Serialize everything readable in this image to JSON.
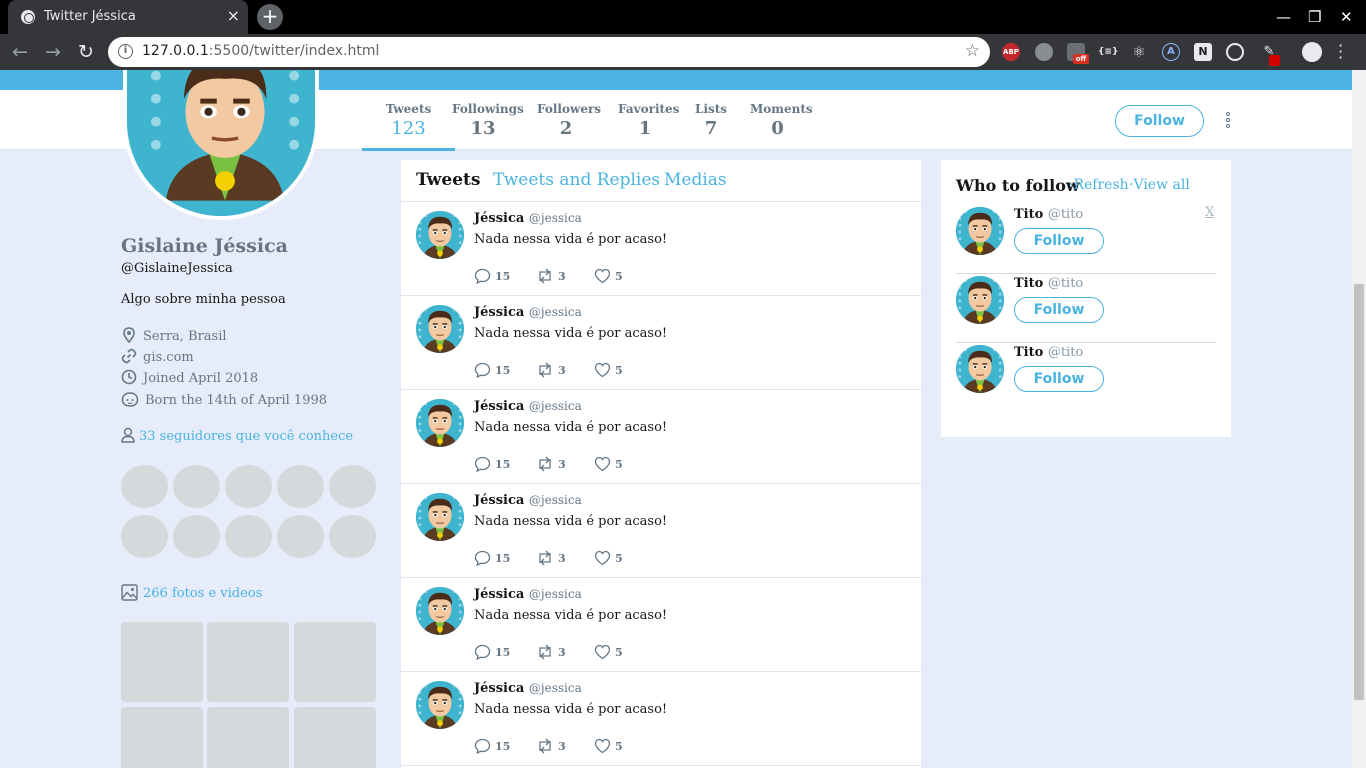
{
  "browser": {
    "tab_title": "Twitter Jéssica",
    "tab_close": "×",
    "new_tab": "+",
    "url_host": "127.0.0.1",
    "url_rest": ":5500/twitter/index.html",
    "window_minimize": "—",
    "window_maximize": "❐",
    "window_close": "✕",
    "ext_abp": "ABP",
    "ext_off": "off",
    "ext_braces": "{≡}",
    "ext_a": "A",
    "ext_n": "N"
  },
  "stats": [
    {
      "label": "Tweets",
      "value": "123",
      "active": true
    },
    {
      "label": "Followings",
      "value": "13"
    },
    {
      "label": "Followers",
      "value": "2"
    },
    {
      "label": "Favorites",
      "value": "1"
    },
    {
      "label": "Lists",
      "value": "7"
    },
    {
      "label": "Moments",
      "value": "0"
    }
  ],
  "header_follow_label": "Follow",
  "profile": {
    "name": "Gislaine Jéssica",
    "handle": "@GislaineJessica",
    "bio": "Algo sobre minha pessoa",
    "location": "Serra, Brasil",
    "website": "gis.com",
    "joined": "Joined April 2018",
    "born": "Born the 14th of April 1998",
    "known_followers": "33 seguidores que você conhece",
    "photos_videos": "266 fotos e videos"
  },
  "timeline": {
    "tabs": [
      "Tweets",
      "Tweets and Replies",
      "Medias"
    ],
    "tweets": [
      {
        "name": "Jéssica",
        "handle": "@jessica",
        "text": "Nada nessa vida é por acaso!",
        "replies": "15",
        "retweets": "3",
        "likes": "5"
      },
      {
        "name": "Jéssica",
        "handle": "@jessica",
        "text": "Nada nessa vida é por acaso!",
        "replies": "15",
        "retweets": "3",
        "likes": "5"
      },
      {
        "name": "Jéssica",
        "handle": "@jessica",
        "text": "Nada nessa vida é por acaso!",
        "replies": "15",
        "retweets": "3",
        "likes": "5"
      },
      {
        "name": "Jéssica",
        "handle": "@jessica",
        "text": "Nada nessa vida é por acaso!",
        "replies": "15",
        "retweets": "3",
        "likes": "5"
      },
      {
        "name": "Jéssica",
        "handle": "@jessica",
        "text": "Nada nessa vida é por acaso!",
        "replies": "15",
        "retweets": "3",
        "likes": "5"
      },
      {
        "name": "Jéssica",
        "handle": "@jessica",
        "text": "Nada nessa vida é por acaso!",
        "replies": "15",
        "retweets": "3",
        "likes": "5"
      }
    ]
  },
  "who_to_follow": {
    "title": "Who to follow",
    "refresh": "Refresh",
    "view_all": "View all",
    "dismiss": "X",
    "suggestions": [
      {
        "name": "Tito",
        "handle": "@tito",
        "follow_label": "Follow"
      },
      {
        "name": "Tito",
        "handle": "@tito",
        "follow_label": "Follow"
      },
      {
        "name": "Tito",
        "handle": "@tito",
        "follow_label": "Follow"
      }
    ]
  },
  "colors": {
    "accent": "#4ab3e2",
    "background": "#e6ecfa",
    "muted_text": "#657786"
  }
}
